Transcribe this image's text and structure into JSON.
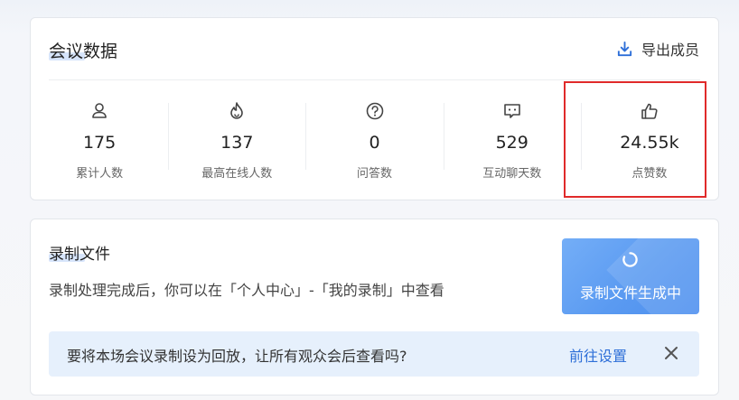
{
  "meeting_data": {
    "title": "会议数据",
    "export_label": "导出成员",
    "stats": [
      {
        "icon": "person-icon",
        "value": "175",
        "label": "累计人数"
      },
      {
        "icon": "flame-icon",
        "value": "137",
        "label": "最高在线人数"
      },
      {
        "icon": "question-circle-icon",
        "value": "0",
        "label": "问答数"
      },
      {
        "icon": "chat-bubble-icon",
        "value": "529",
        "label": "互动聊天数"
      },
      {
        "icon": "thumbs-up-icon",
        "value": "24.55k",
        "label": "点赞数"
      }
    ]
  },
  "recording": {
    "title": "录制文件",
    "description": "录制处理完成后，你可以在「个人中心」-「我的录制」中查看",
    "status_text": "录制文件生成中",
    "tip_text": "要将本场会议录制设为回放，让所有观众会后查看吗?",
    "tip_link": "前往设置"
  },
  "colors": {
    "accent": "#2e6fd8",
    "highlight_border": "#e02a2a",
    "status_bg": "#5a9af1",
    "tip_bg": "#e6f0fc"
  }
}
